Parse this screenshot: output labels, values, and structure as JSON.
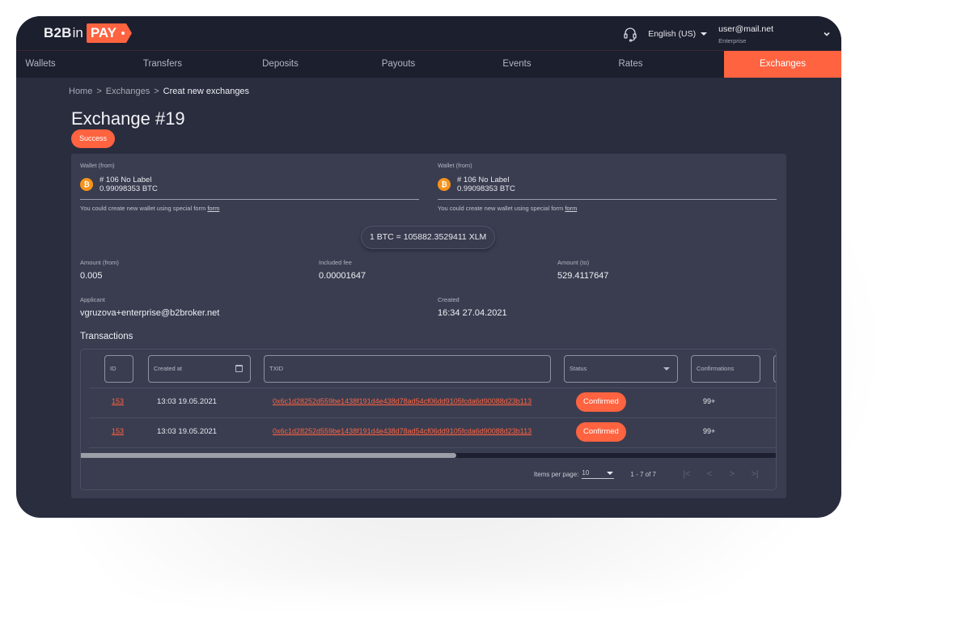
{
  "brand": {
    "b2b": "B2B",
    "in": "in",
    "pay": "PAY"
  },
  "header": {
    "language": "English (US)",
    "user_email": "user@mail.net",
    "user_role": "Enterprise"
  },
  "nav": {
    "items": [
      {
        "label": "Wallets"
      },
      {
        "label": "Transfers"
      },
      {
        "label": "Deposits"
      },
      {
        "label": "Payouts"
      },
      {
        "label": "Events"
      },
      {
        "label": "Rates"
      },
      {
        "label": "Exchanges",
        "active": true
      }
    ]
  },
  "breadcrumb": {
    "home": "Home",
    "section": "Exchanges",
    "current": "Creat new exchanges",
    "separator": ">"
  },
  "page": {
    "title": "Exchange #19",
    "status": "Success"
  },
  "wallets": [
    {
      "label": "Wallet (from)",
      "icon": "bitcoin-icon",
      "icon_glyph": "₿",
      "name": "# 106 No Label",
      "balance": "0.99098353 BTC",
      "hint": "You could create new wallet using special form",
      "hint_link": "form"
    },
    {
      "label": "Wallet (from)",
      "icon": "bitcoin-icon",
      "icon_glyph": "₿",
      "name": "# 106 No Label",
      "balance": "0.99098353 BTC",
      "hint": "You could create new wallet using special form",
      "hint_link": "form"
    }
  ],
  "rate": "1 BTC = 105882.3529411 XLM",
  "details": {
    "amount_from": {
      "label": "Amount (from)",
      "value": "0.005"
    },
    "included_fee": {
      "label": "Included fee",
      "value": "0.00001647"
    },
    "amount_to": {
      "label": "Amount (to)",
      "value": "529.4117647"
    },
    "applicant": {
      "label": "Applicant",
      "value": "vgruzova+enterprise@b2broker.net"
    },
    "created": {
      "label": "Created",
      "value": "16:34 27.04.2021"
    }
  },
  "transactions": {
    "title": "Transactions",
    "filters": {
      "id": "ID",
      "created_at": "Created at",
      "txid": "TXID",
      "status": "Status",
      "confirmations": "Confirmations"
    },
    "rows": [
      {
        "id": "153",
        "created_at": "13:03 19.05.2021",
        "txid": "0x6c1d28252d559be1438f191d4e438d78ad54cf06dd9105fcda6d90088d23b113",
        "status": "Confirmed",
        "confirmations": "99+"
      },
      {
        "id": "153",
        "created_at": "13:03 19.05.2021",
        "txid": "0x6c1d28252d559be1438f191d4e438d78ad54cf06dd9105fcda6d90088d23b113",
        "status": "Confirmed",
        "confirmations": "99+"
      }
    ],
    "scroll_fraction": 0.54,
    "pager": {
      "items_per_page_label": "Items per page:",
      "items_per_page": "10",
      "range": "1 - 7 of 7",
      "first": "|<",
      "prev": "<",
      "next": ">",
      "last": ">|"
    }
  },
  "colors": {
    "accent": "#ff6340",
    "background": "#2a2d3e",
    "card": "#3a3d50",
    "header": "#1c1f2e",
    "bitcoin": "#f7931a"
  }
}
